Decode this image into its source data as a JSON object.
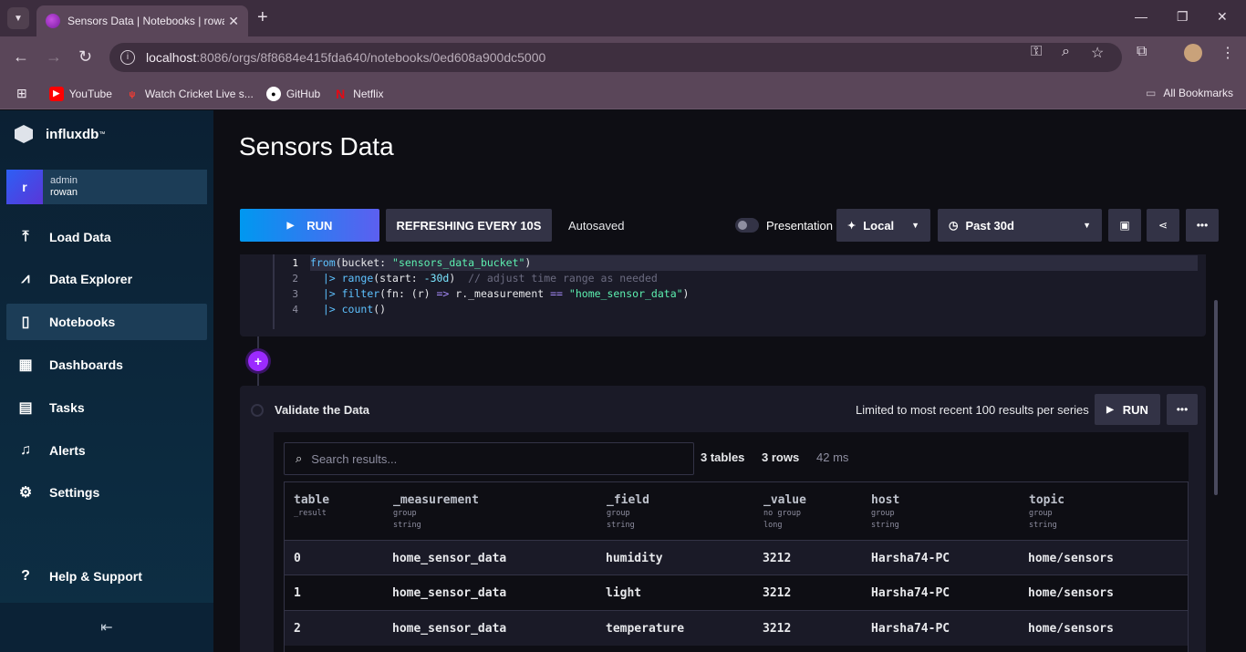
{
  "browser": {
    "tab_title": "Sensors Data | Notebooks | rowan",
    "url_host": "localhost",
    "url_rest": ":8086/orgs/8f8684e415fda640/notebooks/0ed608a900dc5000",
    "bookmarks": [
      {
        "label": "YouTube",
        "icon": "youtube-icon"
      },
      {
        "label": "Watch Cricket Live s...",
        "icon": "cricket-icon"
      },
      {
        "label": "GitHub",
        "icon": "github-icon"
      },
      {
        "label": "Netflix",
        "icon": "netflix-icon"
      }
    ],
    "all_bookmarks": "All Bookmarks"
  },
  "sidebar": {
    "logo": "influxdb",
    "user": {
      "initial": "r",
      "role": "admin",
      "org": "rowan"
    },
    "items": [
      {
        "label": "Load Data",
        "icon": "upload-icon"
      },
      {
        "label": "Data Explorer",
        "icon": "graph-icon"
      },
      {
        "label": "Notebooks",
        "icon": "notebook-icon",
        "active": true
      },
      {
        "label": "Dashboards",
        "icon": "dashboard-icon"
      },
      {
        "label": "Tasks",
        "icon": "calendar-icon"
      },
      {
        "label": "Alerts",
        "icon": "bell-icon"
      },
      {
        "label": "Settings",
        "icon": "gear-icon"
      }
    ],
    "help": "Help & Support"
  },
  "toolbar": {
    "title": "Sensors Data",
    "run": "RUN",
    "refresh": "REFRESHING EVERY 10S",
    "autosaved": "Autosaved",
    "presentation": "Presentation",
    "timezone": "Local",
    "range": "Past 30d"
  },
  "code": {
    "lines": [
      {
        "num": "1"
      },
      {
        "num": "2"
      },
      {
        "num": "3"
      },
      {
        "num": "4"
      }
    ],
    "l1_from": "from",
    "l1_a": "(bucket: ",
    "l1_str": "\"sensors_data_bucket\"",
    "l1_b": ")",
    "l2_pipe": "  |> ",
    "l2_fn": "range",
    "l2_a": "(start: ",
    "l2_num": "-30d",
    "l2_b": ")  ",
    "l2_comment": "// adjust time range as needed",
    "l3_pipe": "  |> ",
    "l3_fn": "filter",
    "l3_a": "(fn: (r) ",
    "l3_arrow": "=>",
    "l3_b": " r._measurement ",
    "l3_eq": "==",
    "l3_sp": " ",
    "l3_str": "\"home_sensor_data\"",
    "l3_c": ")",
    "l4_pipe": "  |> ",
    "l4_fn": "count",
    "l4_a": "()"
  },
  "cell": {
    "title": "Validate the Data",
    "limited": "Limited to most recent 100 results per series",
    "run": "RUN",
    "search_placeholder": "Search results...",
    "tables": "3 tables",
    "rows": "3 rows",
    "time": "42 ms"
  },
  "table": {
    "columns": [
      {
        "name": "table",
        "meta1": "_result",
        "meta2": ""
      },
      {
        "name": "_measurement",
        "meta1": "group",
        "meta2": "string"
      },
      {
        "name": "_field",
        "meta1": "group",
        "meta2": "string"
      },
      {
        "name": "_value",
        "meta1": "no group",
        "meta2": "long"
      },
      {
        "name": "host",
        "meta1": "group",
        "meta2": "string"
      },
      {
        "name": "topic",
        "meta1": "group",
        "meta2": "string"
      }
    ],
    "rows": [
      [
        "0",
        "home_sensor_data",
        "humidity",
        "3212",
        "Harsha74-PC",
        "home/sensors"
      ],
      [
        "1",
        "home_sensor_data",
        "light",
        "3212",
        "Harsha74-PC",
        "home/sensors"
      ],
      [
        "2",
        "home_sensor_data",
        "temperature",
        "3212",
        "Harsha74-PC",
        "home/sensors"
      ]
    ]
  }
}
